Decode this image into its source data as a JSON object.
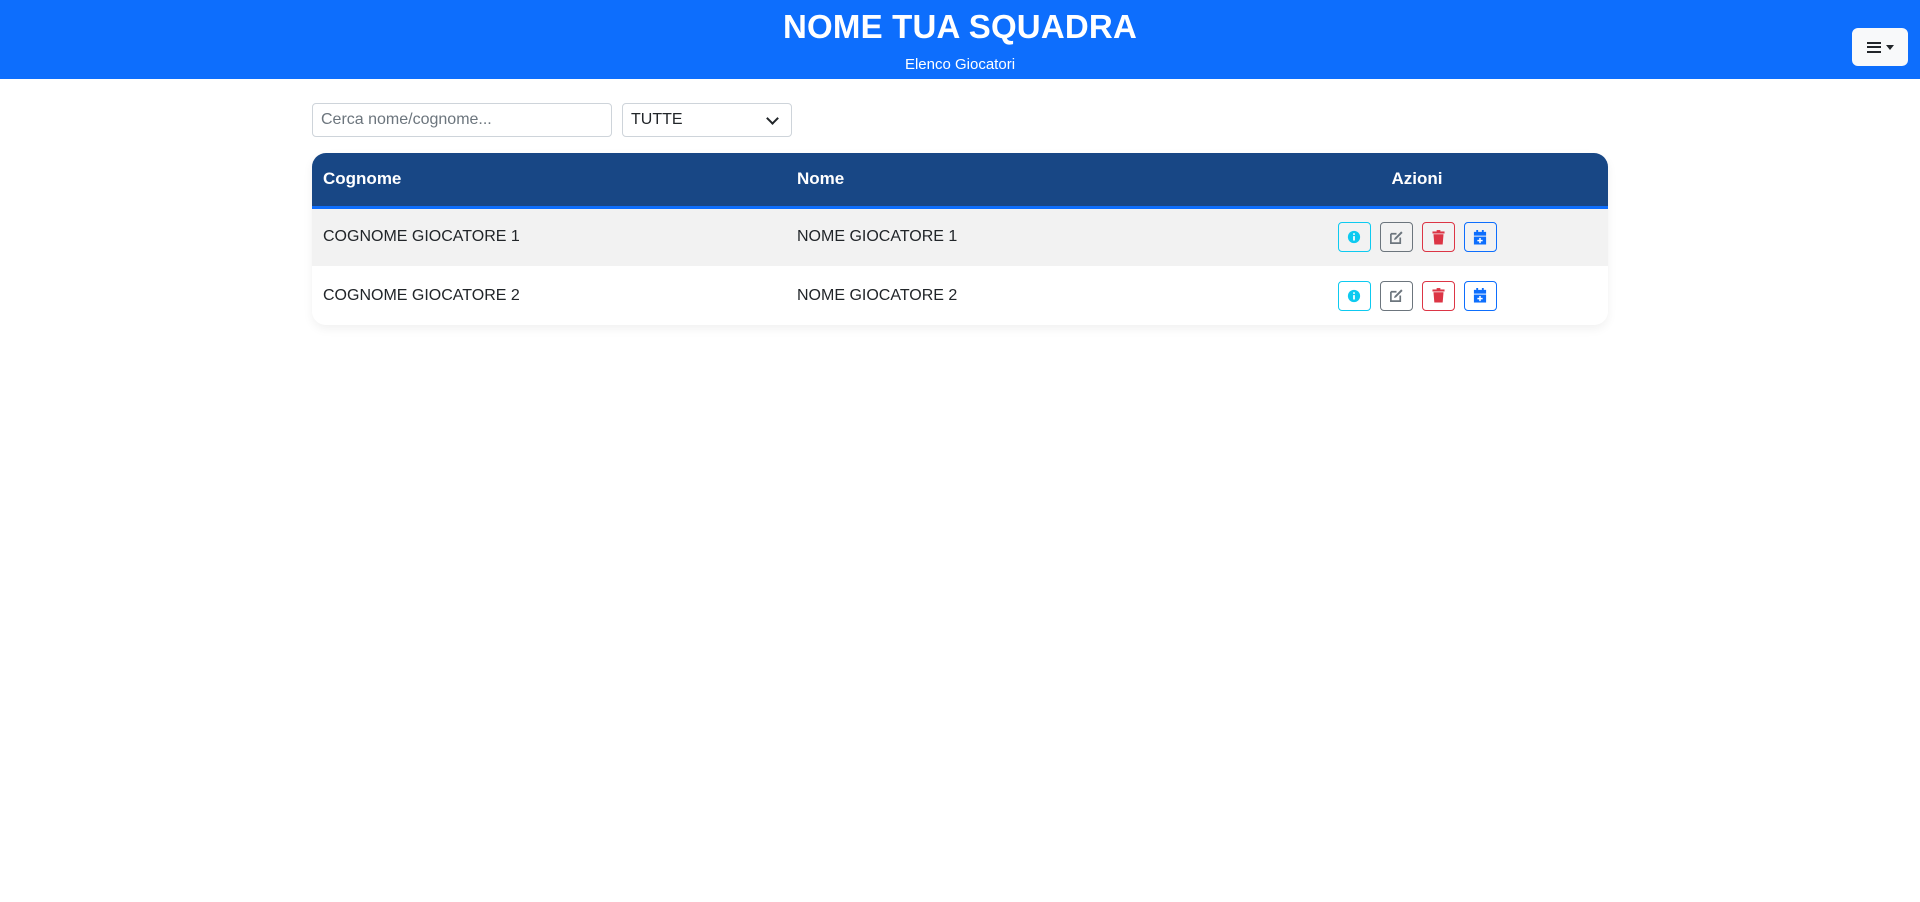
{
  "header": {
    "title": "NOME TUA SQUADRA",
    "subtitle": "Elenco Giocatori",
    "menu_icon": "hamburger-dropdown-icon"
  },
  "filters": {
    "search_placeholder": "Cerca nome/cognome...",
    "search_value": "",
    "select_value": "TUTTE"
  },
  "table": {
    "headers": {
      "cognome": "Cognome",
      "nome": "Nome",
      "azioni": "Azioni"
    },
    "rows": [
      {
        "cognome": "COGNOME GIOCATORE 1",
        "nome": "NOME GIOCATORE 1"
      },
      {
        "cognome": "COGNOME GIOCATORE 2",
        "nome": "NOME GIOCATORE 2"
      }
    ],
    "action_icons": [
      "info-icon",
      "edit-icon",
      "trash-icon",
      "calendar-plus-icon"
    ]
  },
  "colors": {
    "header_bg": "#0d6efd",
    "table_header_bg": "#184785",
    "info": "#0dcaf0",
    "secondary": "#6c757d",
    "danger": "#dc3545",
    "primary": "#0d6efd"
  }
}
